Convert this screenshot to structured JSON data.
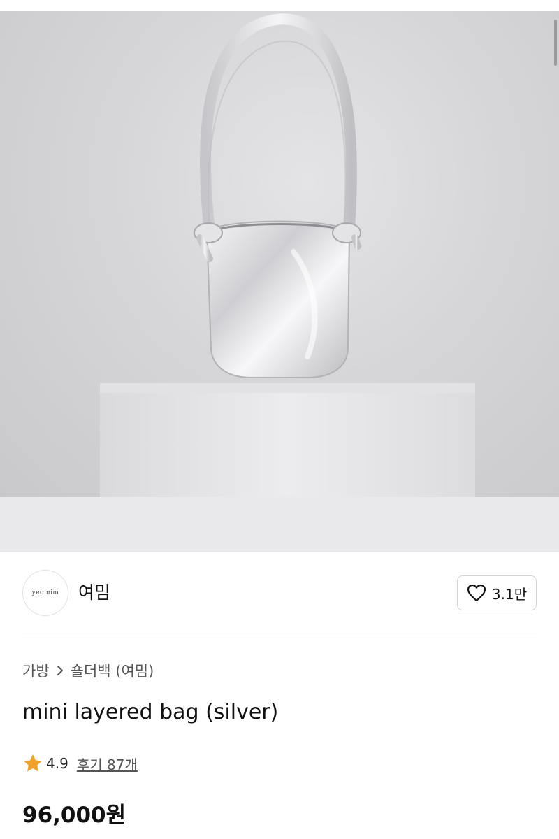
{
  "product_image": {
    "alt": ""
  },
  "brand": {
    "logo_text": "yeomim",
    "name": "여밈"
  },
  "like": {
    "count": "3.1만"
  },
  "breadcrumb": {
    "category": "가방",
    "subcategory": "숄더백 (여밈)"
  },
  "product": {
    "title": "mini layered bag (silver)",
    "rating": "4.9",
    "reviews_label": "후기 87개",
    "price": "96,000원"
  },
  "icons": {
    "like": "heart-icon",
    "breadcrumb_separator": "chevron-right-icon",
    "rating": "star-icon"
  },
  "colors": {
    "star": "#F0A12A",
    "text": "#111111",
    "muted": "#555555"
  }
}
